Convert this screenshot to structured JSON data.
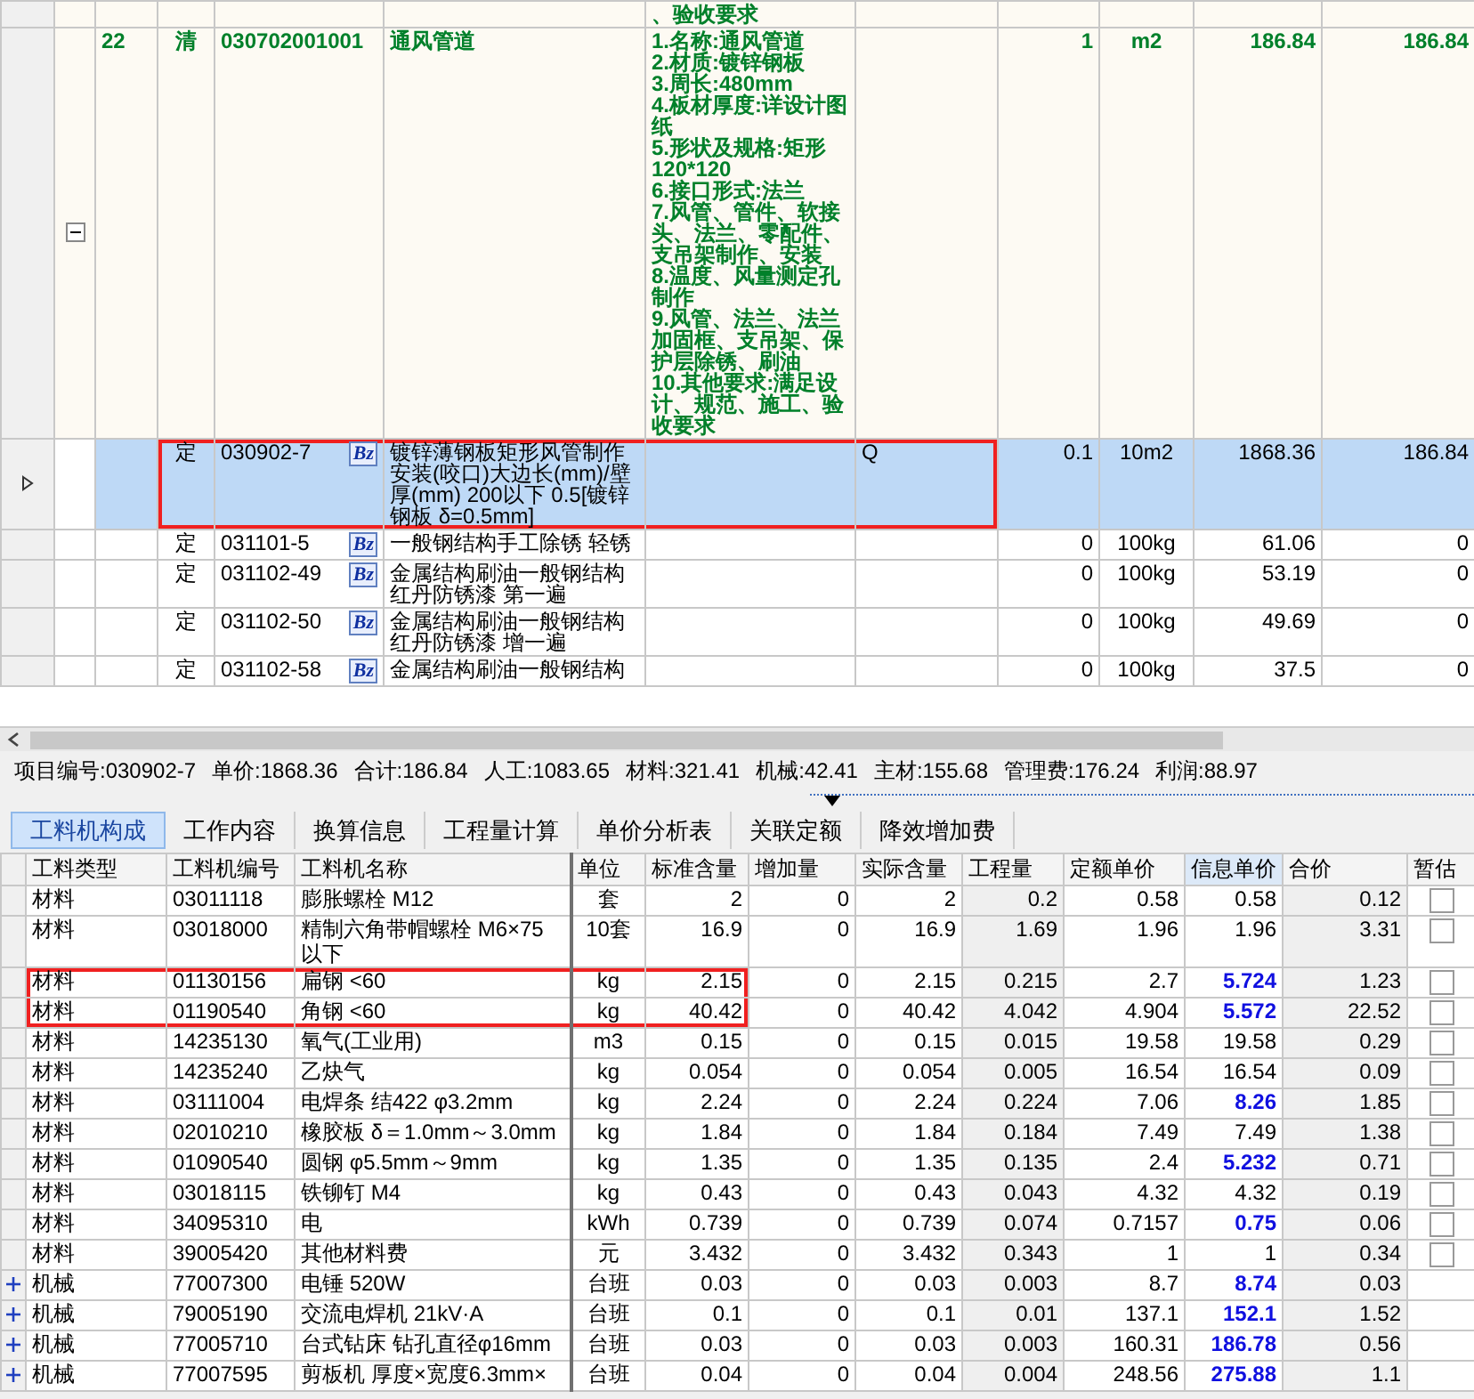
{
  "upper_grid": {
    "rows": [
      {
        "kind": "continuation",
        "features": [
          "、验收要求"
        ],
        "selected": false,
        "highlighted": false
      },
      {
        "kind": "bill",
        "number": "22",
        "type": "清",
        "code": "030702001001",
        "name": "通风管道",
        "features": [
          "1.名称:通风管道",
          "2.材质:镀锌钢板",
          "3.周长:480mm",
          "4.板材厚度:详设计图纸",
          "5.形状及规格:矩形120*120",
          "6.接口形式:法兰",
          "7.风管、管件、软接头、法兰、零配件、支吊架制作、安装",
          "8.温度、风量测定孔制作",
          "9.风管、法兰、法兰加固框、支吊架、保护层除锈、刷油",
          "10.其他要求:满足设计、规范、施工、验收要求"
        ],
        "column_8": "",
        "quantity": "1",
        "unit": "m2",
        "unit_price": "186.84",
        "total": "186.84",
        "expanded": true,
        "selected": false,
        "highlighted": false
      },
      {
        "kind": "quota",
        "type": "定",
        "code": "030902-7",
        "badge": "Bz",
        "name": "镀锌薄钢板矩形风管制作安装(咬口)大边长(mm)/壁厚(mm) 200以下 0.5[镀锌钢板 δ=0.5mm]",
        "column_8": "Q",
        "quantity": "0.1",
        "unit": "10m2",
        "unit_price": "1868.36",
        "total": "186.84",
        "selected": true,
        "highlighted": true
      },
      {
        "kind": "quota",
        "type": "定",
        "code": "031101-5",
        "badge": "Bz",
        "name": "一般钢结构手工除锈 轻锈",
        "column_8": "",
        "quantity": "0",
        "unit": "100kg",
        "unit_price": "61.06",
        "total": "0",
        "selected": false,
        "highlighted": false
      },
      {
        "kind": "quota",
        "type": "定",
        "code": "031102-49",
        "badge": "Bz",
        "name": "金属结构刷油一般钢结构红丹防锈漆 第一遍",
        "column_8": "",
        "quantity": "0",
        "unit": "100kg",
        "unit_price": "53.19",
        "total": "0",
        "selected": false,
        "highlighted": false
      },
      {
        "kind": "quota",
        "type": "定",
        "code": "031102-50",
        "badge": "Bz",
        "name": "金属结构刷油一般钢结构红丹防锈漆 增一遍",
        "column_8": "",
        "quantity": "0",
        "unit": "100kg",
        "unit_price": "49.69",
        "total": "0",
        "selected": false,
        "highlighted": false
      },
      {
        "kind": "quota",
        "type": "定",
        "code": "031102-58",
        "badge": "Bz",
        "name": "金属结构刷油一般钢结构",
        "column_8": "",
        "quantity": "0",
        "unit": "100kg",
        "unit_price": "37.5",
        "total": "0",
        "selected": false,
        "highlighted": false
      }
    ]
  },
  "summary": [
    "项目编号:030902-7",
    "单价:1868.36",
    "合计:186.84",
    "人工:1083.65",
    "材料:321.41",
    "机械:42.41",
    "主材:155.68",
    "管理费:176.24",
    "利润:88.97"
  ],
  "tabs": [
    {
      "label": "工料机构成",
      "selected": true
    },
    {
      "label": "工作内容",
      "selected": false
    },
    {
      "label": "换算信息",
      "selected": false
    },
    {
      "label": "工程量计算",
      "selected": false
    },
    {
      "label": "单价分析表",
      "selected": false
    },
    {
      "label": "关联定额",
      "selected": false
    },
    {
      "label": "降效增加费",
      "selected": false
    }
  ],
  "resource_table": {
    "columns": [
      {
        "label": "工料类型",
        "readonly": false,
        "focused": false
      },
      {
        "label": "工料机编号",
        "readonly": false,
        "focused": false
      },
      {
        "label": "工料机名称",
        "readonly": false,
        "focused": false
      },
      {
        "label": "单位",
        "readonly": false,
        "focused": false
      },
      {
        "label": "标准含量",
        "readonly": false,
        "focused": false
      },
      {
        "label": "增加量",
        "readonly": false,
        "focused": false
      },
      {
        "label": "实际含量",
        "readonly": false,
        "focused": false
      },
      {
        "label": "工程量",
        "readonly": true,
        "focused": false
      },
      {
        "label": "定额单价",
        "readonly": false,
        "focused": false
      },
      {
        "label": "信息单价",
        "readonly": false,
        "focused": true
      },
      {
        "label": "合价",
        "readonly": true,
        "focused": false
      },
      {
        "label": "暂估",
        "readonly": false,
        "focused": false
      }
    ],
    "rows": [
      {
        "kind": "material",
        "type": "材料",
        "code": "03011118",
        "name": "膨胀螺栓 M12",
        "unit": "套",
        "standard": "2",
        "added": "0",
        "actual": "2",
        "quantity": "0.2",
        "quota_price": "0.58",
        "info_price": "0.58",
        "info_adjusted": false,
        "total": "0.12",
        "checked": false,
        "highlighted": false
      },
      {
        "kind": "material",
        "type": "材料",
        "code": "03018000",
        "name": "精制六角带帽螺栓 M6×75以下",
        "unit": "10套",
        "standard": "16.9",
        "added": "0",
        "actual": "16.9",
        "quantity": "1.69",
        "quota_price": "1.96",
        "info_price": "1.96",
        "info_adjusted": false,
        "total": "3.31",
        "checked": false,
        "highlighted": false
      },
      {
        "kind": "material",
        "type": "材料",
        "code": "01130156",
        "name": "扁钢 <60",
        "unit": "kg",
        "standard": "2.15",
        "added": "0",
        "actual": "2.15",
        "quantity": "0.215",
        "quota_price": "2.7",
        "info_price": "5.724",
        "info_adjusted": true,
        "total": "1.23",
        "checked": false,
        "highlighted": true
      },
      {
        "kind": "material",
        "type": "材料",
        "code": "01190540",
        "name": "角钢 <60",
        "unit": "kg",
        "standard": "40.42",
        "added": "0",
        "actual": "40.42",
        "quantity": "4.042",
        "quota_price": "4.904",
        "info_price": "5.572",
        "info_adjusted": true,
        "total": "22.52",
        "checked": false,
        "highlighted": true
      },
      {
        "kind": "material",
        "type": "材料",
        "code": "14235130",
        "name": "氧气(工业用)",
        "unit": "m3",
        "standard": "0.15",
        "added": "0",
        "actual": "0.15",
        "quantity": "0.015",
        "quota_price": "19.58",
        "info_price": "19.58",
        "info_adjusted": false,
        "total": "0.29",
        "checked": false,
        "highlighted": false
      },
      {
        "kind": "material",
        "type": "材料",
        "code": "14235240",
        "name": "乙炔气",
        "unit": "kg",
        "standard": "0.054",
        "added": "0",
        "actual": "0.054",
        "quantity": "0.005",
        "quota_price": "16.54",
        "info_price": "16.54",
        "info_adjusted": false,
        "total": "0.09",
        "checked": false,
        "highlighted": false
      },
      {
        "kind": "material",
        "type": "材料",
        "code": "03111004",
        "name": "电焊条 结422 φ3.2mm",
        "unit": "kg",
        "standard": "2.24",
        "added": "0",
        "actual": "2.24",
        "quantity": "0.224",
        "quota_price": "7.06",
        "info_price": "8.26",
        "info_adjusted": true,
        "total": "1.85",
        "checked": false,
        "highlighted": false
      },
      {
        "kind": "material",
        "type": "材料",
        "code": "02010210",
        "name": "橡胶板 δ＝1.0mm～3.0mm",
        "unit": "kg",
        "standard": "1.84",
        "added": "0",
        "actual": "1.84",
        "quantity": "0.184",
        "quota_price": "7.49",
        "info_price": "7.49",
        "info_adjusted": false,
        "total": "1.38",
        "checked": false,
        "highlighted": false
      },
      {
        "kind": "material",
        "type": "材料",
        "code": "01090540",
        "name": "圆钢 φ5.5mm～9mm",
        "unit": "kg",
        "standard": "1.35",
        "added": "0",
        "actual": "1.35",
        "quantity": "0.135",
        "quota_price": "2.4",
        "info_price": "5.232",
        "info_adjusted": true,
        "total": "0.71",
        "checked": false,
        "highlighted": false
      },
      {
        "kind": "material",
        "type": "材料",
        "code": "03018115",
        "name": "铁铆钉 M4",
        "unit": "kg",
        "standard": "0.43",
        "added": "0",
        "actual": "0.43",
        "quantity": "0.043",
        "quota_price": "4.32",
        "info_price": "4.32",
        "info_adjusted": false,
        "total": "0.19",
        "checked": false,
        "highlighted": false
      },
      {
        "kind": "material",
        "type": "材料",
        "code": "34095310",
        "name": "电",
        "unit": "kWh",
        "standard": "0.739",
        "added": "0",
        "actual": "0.739",
        "quantity": "0.074",
        "quota_price": "0.7157",
        "info_price": "0.75",
        "info_adjusted": true,
        "total": "0.06",
        "checked": false,
        "highlighted": false
      },
      {
        "kind": "material",
        "type": "材料",
        "code": "39005420",
        "name": "其他材料费",
        "unit": "元",
        "standard": "3.432",
        "added": "0",
        "actual": "3.432",
        "quantity": "0.343",
        "quota_price": "1",
        "info_price": "1",
        "info_adjusted": false,
        "total": "0.34",
        "checked": false,
        "highlighted": false
      },
      {
        "kind": "machine",
        "type": "机械",
        "code": "77007300",
        "name": "电锤 520W",
        "unit": "台班",
        "standard": "0.03",
        "added": "0",
        "actual": "0.03",
        "quantity": "0.003",
        "quota_price": "8.7",
        "info_price": "8.74",
        "info_adjusted": true,
        "total": "0.03",
        "expanded": false,
        "highlighted": false
      },
      {
        "kind": "machine",
        "type": "机械",
        "code": "79005190",
        "name": "交流电焊机 21kV·A",
        "unit": "台班",
        "standard": "0.1",
        "added": "0",
        "actual": "0.1",
        "quantity": "0.01",
        "quota_price": "137.1",
        "info_price": "152.1",
        "info_adjusted": true,
        "total": "1.52",
        "expanded": false,
        "highlighted": false
      },
      {
        "kind": "machine",
        "type": "机械",
        "code": "77005710",
        "name": "台式钻床 钻孔直径φ16mm",
        "unit": "台班",
        "standard": "0.03",
        "added": "0",
        "actual": "0.03",
        "quantity": "0.003",
        "quota_price": "160.31",
        "info_price": "186.78",
        "info_adjusted": true,
        "total": "0.56",
        "expanded": false,
        "highlighted": false
      },
      {
        "kind": "machine",
        "type": "机械",
        "code": "77007595",
        "name": "剪板机 厚度×宽度6.3mm×",
        "unit": "台班",
        "standard": "0.04",
        "added": "0",
        "actual": "0.04",
        "quantity": "0.004",
        "quota_price": "248.56",
        "info_price": "275.88",
        "info_adjusted": true,
        "total": "1.1",
        "expanded": false,
        "highlighted": false
      }
    ]
  }
}
